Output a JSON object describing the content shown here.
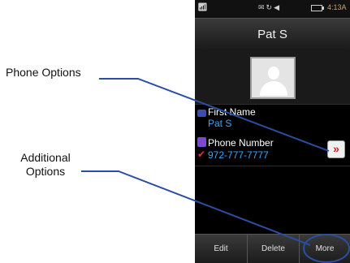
{
  "callouts": {
    "phone_options": "Phone Options",
    "additional_line1": "Additional",
    "additional_line2": "Options"
  },
  "status_bar": {
    "time": "4:13A"
  },
  "header": {
    "title": "Pat S"
  },
  "fields": [
    {
      "label": "First Name",
      "value": "Pat S"
    },
    {
      "label": "Phone Number",
      "value": "972-777-7777"
    }
  ],
  "phone_options_glyph": "»",
  "softkeys": {
    "edit": "Edit",
    "delete": "Delete",
    "more": "More"
  },
  "colors": {
    "field_value": "#3aa6ff",
    "callout_line": "#2a4ea0"
  },
  "icons": {
    "name_field": "contact-card-icon",
    "phone_field": "phone-icon",
    "default_marker": "checkmark-icon",
    "phone_options": "double-chevron-right-icon"
  }
}
